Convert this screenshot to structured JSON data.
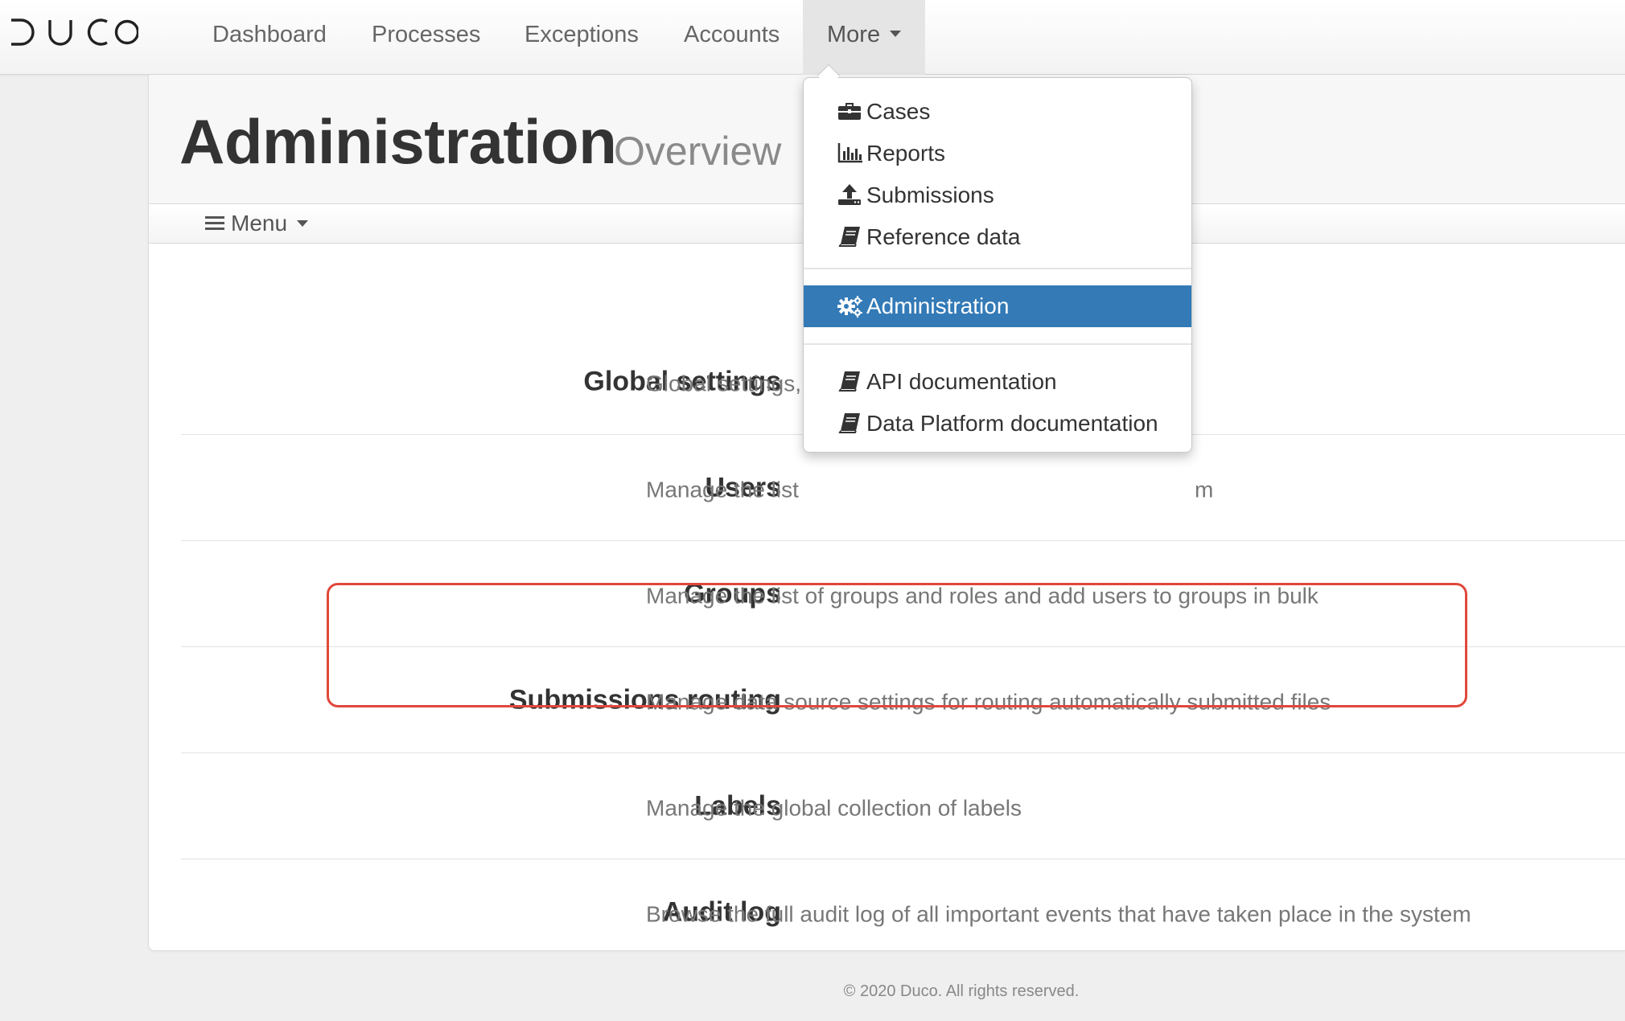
{
  "brand": {
    "logo_text": "DUCO"
  },
  "nav": {
    "items": [
      {
        "label": "Dashboard"
      },
      {
        "label": "Processes"
      },
      {
        "label": "Exceptions"
      },
      {
        "label": "Accounts"
      }
    ],
    "more_label": "More"
  },
  "dropdown": {
    "groups": [
      [
        {
          "label": "Cases",
          "icon": "briefcase-icon"
        },
        {
          "label": "Reports",
          "icon": "bar-chart-icon"
        },
        {
          "label": "Submissions",
          "icon": "upload-icon"
        },
        {
          "label": "Reference data",
          "icon": "book-icon"
        }
      ],
      [
        {
          "label": "Administration",
          "icon": "gears-icon",
          "active": true
        }
      ],
      [
        {
          "label": "API documentation",
          "icon": "book-icon"
        },
        {
          "label": "Data Platform documentation",
          "icon": "book-icon"
        }
      ]
    ],
    "active_color": "#337ab7"
  },
  "page": {
    "title": "Administration",
    "subtitle": "Overview",
    "menu_label": "Menu"
  },
  "settings": [
    {
      "title": "Global settings",
      "description": "Global settings,"
    },
    {
      "title": "Users",
      "description": "Manage the list",
      "description_tail": "m"
    },
    {
      "title": "Groups",
      "description": "Manage the list of groups and roles and add users to groups in bulk"
    },
    {
      "title": "Submissions routing",
      "description": "Manage data source settings for routing automatically submitted files",
      "highlighted": true
    },
    {
      "title": "Labels",
      "description": "Manage the global collection of labels"
    },
    {
      "title": "Audit log",
      "description": "Browse the full audit log of all important events that have taken place in the system"
    }
  ],
  "highlight_color": "#e0483b",
  "footer": {
    "text": "© 2020 Duco. All rights reserved."
  }
}
